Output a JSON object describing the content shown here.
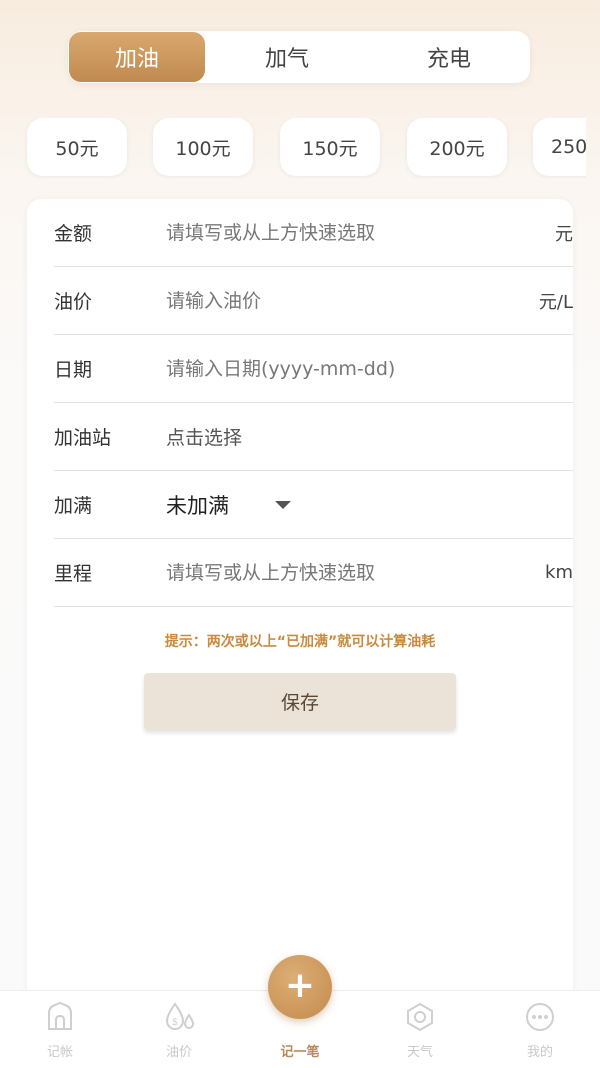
{
  "tabs": [
    {
      "label": "加油",
      "active": true
    },
    {
      "label": "加气",
      "active": false
    },
    {
      "label": "充电",
      "active": false
    }
  ],
  "quick_amounts": [
    "50元",
    "100元",
    "150元",
    "200元",
    "250"
  ],
  "form": {
    "amount": {
      "label": "金额",
      "placeholder": "请填写或从上方快速选取",
      "unit": "元"
    },
    "price": {
      "label": "油价",
      "placeholder": "请输入油价",
      "unit": "元/L"
    },
    "date": {
      "label": "日期",
      "placeholder": "请输入日期(yyyy-mm-dd)"
    },
    "station": {
      "label": "加油站",
      "value": "点击选择"
    },
    "full": {
      "label": "加满",
      "value": "未加满"
    },
    "mileage": {
      "label": "里程",
      "placeholder": "请填写或从上方快速选取",
      "unit": "km"
    }
  },
  "tip": "提示：两次或以上“已加满”就可以计算油耗",
  "save_label": "保存",
  "fab_icon": "plus-icon",
  "nav": [
    {
      "label": "记帐",
      "icon": "home-icon",
      "active": false
    },
    {
      "label": "油价",
      "icon": "oil-drop-icon",
      "active": false
    },
    {
      "label": "记一笔",
      "icon": "plus-icon",
      "active": true
    },
    {
      "label": "天气",
      "icon": "hexagon-icon",
      "active": false
    },
    {
      "label": "我的",
      "icon": "more-icon",
      "active": false
    }
  ],
  "colors": {
    "accent": "#c9945a",
    "tip": "#c98a3e",
    "inactive_nav": "#c9c9c9"
  }
}
